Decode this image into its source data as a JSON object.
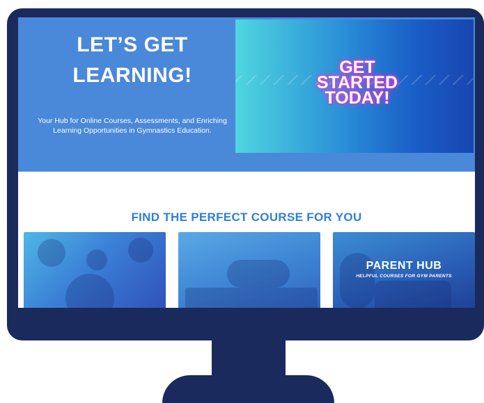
{
  "hero": {
    "title_line1": "LET’S GET",
    "title_line2": "LEARNING!",
    "subtitle": "Your Hub for Online Courses, Assessments, and Enriching Learning Opportunities in Gymnastics Education.",
    "banner_text": "GET\nSTARTED\nTODAY!"
  },
  "courses": {
    "heading": "FIND THE PERFECT COURSE FOR YOU",
    "cards": [
      {
        "title": "",
        "subtitle": ""
      },
      {
        "title": "",
        "subtitle": ""
      },
      {
        "title": "PARENT HUB",
        "subtitle": "HELPFUL COURSES FOR GYM PARENTS"
      }
    ]
  },
  "colors": {
    "monitor": "#1b2a5c",
    "hero_bg": "#4a88da",
    "heading": "#2f7fd3",
    "glow": "#e23bd6"
  }
}
